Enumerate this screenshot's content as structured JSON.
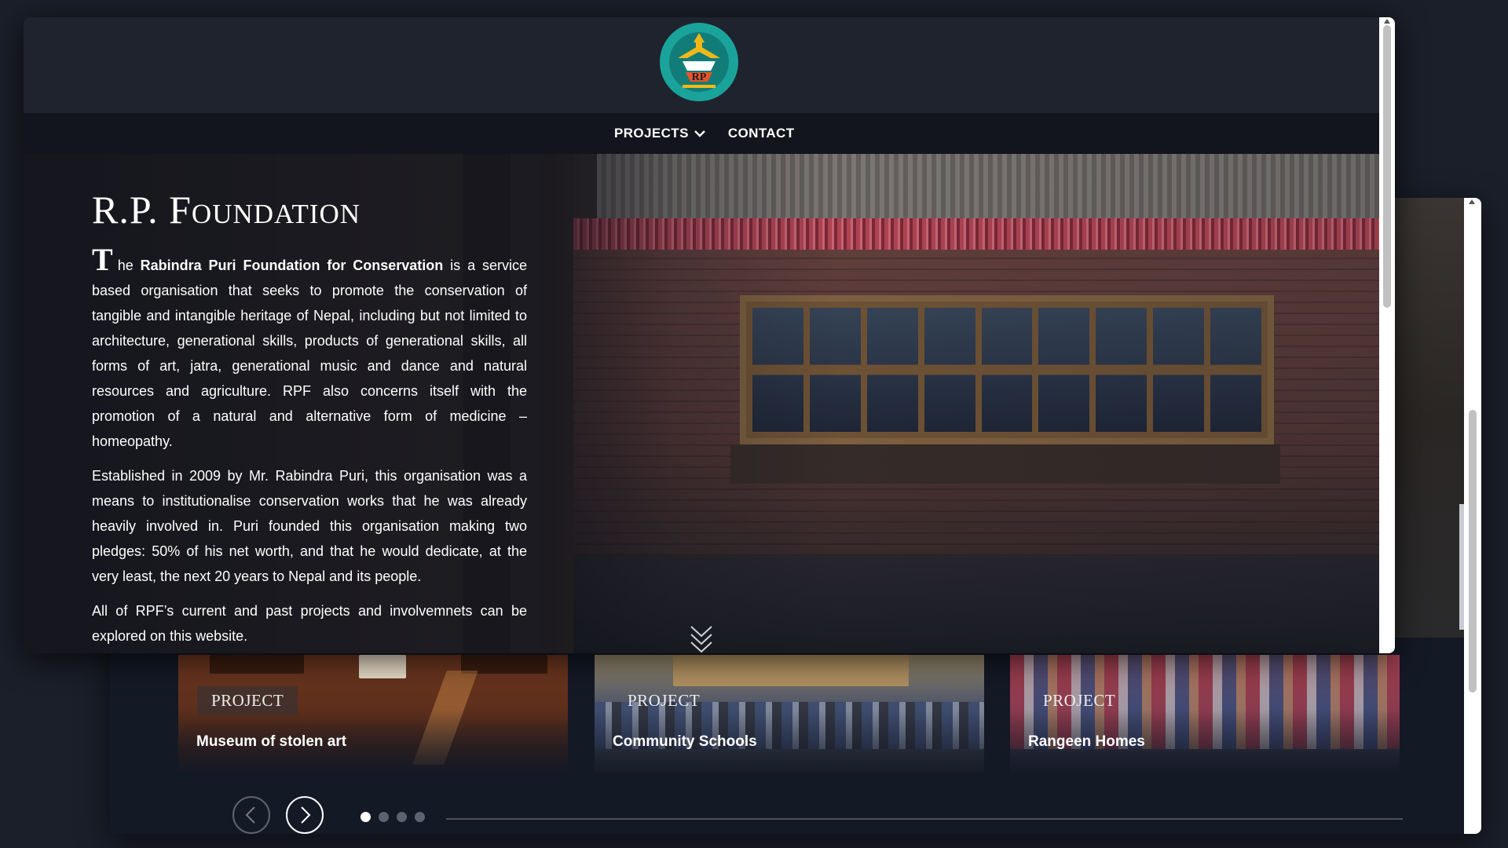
{
  "site": {
    "logo_icon": "rpf-logo-icon",
    "logo_text": "Rabindra Puri Foundation for Conservation",
    "logo_initials": "RP"
  },
  "nav": {
    "projects_label": "PROJECTS",
    "projects_icon": "chevron-down-icon",
    "contact_label": "CONTACT"
  },
  "hero": {
    "title": "R.P. Foundation",
    "dropcap": "T",
    "p1_lead": "he ",
    "p1_bold": "Rabindra Puri Foundation for Conservation",
    "p1_rest": " is a service based organisation that seeks to promote the conservation of tangible and intangible heritage of Nepal, including but not limited to architecture, generational skills, products of generational skills, all forms of art, jatra, generational music and dance and natural resources and agriculture. RPF also concerns itself with the promotion of a natural and alternative form of medicine – homeopathy.",
    "p2": "Established in 2009 by Mr. Rabindra Puri, this organisation was a means to institutionalise conservation works that he was already heavily involved in. Puri founded this organisation making two pledges: 50% of his net worth, and that he would dedicate, at the very least, the next 20 years to Nepal and its people.",
    "p3": "All of RPF’s current and past projects and involvemnets can be explored on this website.",
    "scroll_icon": "double-chevron-down-icon"
  },
  "projects": {
    "cards": [
      {
        "tag": "PROJECT",
        "title": "Museum of stolen art"
      },
      {
        "tag": "PROJECT",
        "title": "Community Schools"
      },
      {
        "tag": "PROJECT",
        "title": "Rangeen Homes"
      }
    ],
    "prev_icon": "chevron-left-icon",
    "next_icon": "chevron-right-icon",
    "slide_count": 4,
    "active_slide": 1
  },
  "colors": {
    "page_bg": "#1b1f2a",
    "navbar_bg": "#12151d",
    "text": "#ffffff",
    "logo_teal": "#1aa39a",
    "logo_gold": "#f2b818"
  }
}
